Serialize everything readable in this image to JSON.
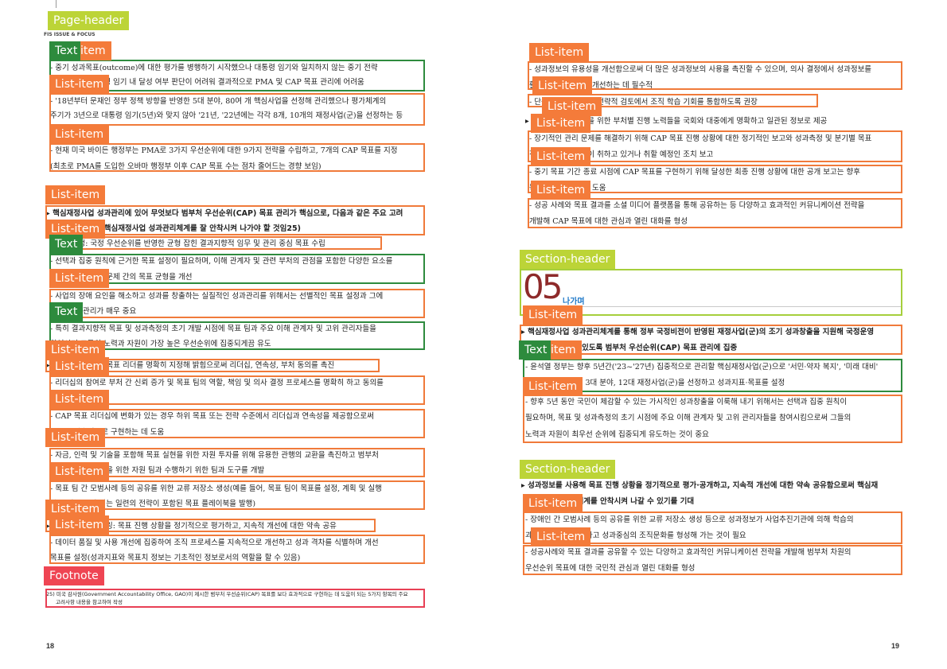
{
  "page_header": {
    "text": "FIS ISSUE & FOCUS"
  },
  "page_numbers": {
    "left": "18",
    "right": "19"
  },
  "section_number": "05",
  "section_title": "나가며",
  "footnote": {
    "line1": "25) 미국 감사원(Government Accountability Office, GAO)이 제시한 범부처 우선순위(CAP) 목표를 보다 효과적으로 구현하는 데 도움이 되는 5가지 항목의 주요",
    "line2": "고려사항 내용을 참고하여 작성"
  },
  "labels": {
    "page_header": "Page-header",
    "text": "Text",
    "list_item": "List-item",
    "section_header": "Section-header",
    "footnote": "Footnote"
  },
  "left_lines": [
    "- 중기 성과목표(outcome)에 대한 평가를 병행하기 시작했으나 대통령 임기와 일치하지 않는 중기 전략",
    "  목표 특성상 대통령 임기 내 달성 여부 판단이 어려워 결과적으로 PMA 및 CAP 목표 관리에 어려움",
    "- '18년부터 문재인 정부 정책 방향을 반영한 5대 분야, 80여 개 핵심사업을 선정해 관리했으나 평가체계의",
    "  주기가 3년으로 대통령 임기(5년)와 맞지 않아 '21년, '22년에는 각각 8개, 10개의 재정사업(군)을 선정하는 등",
    "- 현재 미국 바이든 행정부는 PMA로 3가지 우선순위에 대한 9가지 전략을 수립하고, 7개의 CAP 목표를 지정",
    "  (최초로 PMA를 도입한 오바마 행정부 이후 CAP 목표 수는 점차 줄어드는 경향 보임)",
    "▸ 핵심재정사업 성과관리에 있어 무엇보다 범부처 우선순위(CAP) 목표 관리가 핵심으로, 다음과 같은 주요 고려",
    "  사항을 반영하여 핵심재정사업 성과관리체계를 잘 안착시켜 나가야 할 것임25)",
    "- 목표 설정: 국정 우선순위를 반영한 균형 잡힌 결과지향적 임무 및 관리 중심 목표 수립",
    "- 선택과 집중 원칙에 근거한 목표 설정이 필요하며, 이해 관계자 및 관련 부처의 관점을 포함한 다양한 요소를",
    "  반영하여 관리 및 문제 간의 목표 균형을 개선",
    "- 사업의 장애 요인을 해소하고 성과를 창출하는 실질적인 성과관리를 위해서는 선별적인 목표 설정과 그에",
    "  따른 집중 관리가 매우 중요",
    "- 특히 결과지향적 목표 및 성과측정의 초기 개발 시점에 목표 팀과 주요 이해 관계자 및 고위 관리자들을",
    "  참여시켜 그들의 노력과 자원이 가장 높은 우선순위에 집중되게끔 유도",
    "▸ 리더십: 각 CAP 목표 리더를 명확히 지정해 밝힘으로써 리더십, 연속성, 부처 동의를 촉진",
    "- 리더십의 참여로 부처 간 신뢰 증가 및 목표 팀의 역할, 책임 및 의사 결정 프로세스를 명확히 하고 동의를",
    "  촉진",
    "- CAP 목표 리더십에 변화가 있는 경우 하위 목표 또는 전략 수준에서 리더십과 연속성을 제공함으로써",
    "  목표를 지속적으로 구현하는 데 도움",
    "- 자금, 인력 및 기술을 포함해 목표 실현을 위한 자원 투자를 위해 유용한 관행의 교환을 촉진하고 범부처",
    "  목표 계획 및 조정을 위한 자원 팀과 수행하기 위한 팀과 도구를 개발",
    "- 목표 팀 간 모범사례 등의 공유를 위한 교류 저장소 생성(예를 들어, 목표 팀이 목표를 설정, 계획 및 실행",
    "  하는 데 도움이 되는 일련의 전략이 포함된 목표 플레이북을 발행)",
    "▸ 진행 상황 모니터링: 목표 진행 상황을 정기적으로 평가하고, 지속적 개선에 대한 약속 공유",
    "- 데이터 품질 및 사용 개선에 집중하여 조직 프로세스를 지속적으로 개선하고 성과 격차를 식별하며 개선",
    "  목표를 설정(성과지표와 목표치 정보는 기초적인 정보로서의 역할을 할 수 있음)"
  ],
  "right_lines": [
    "- 성과정보의 유용성을 개선함으로써 더 많은 성과정보의 사용을 촉진할 수 있으며, 의사 결정에서 성과정보를",
    "  활용해 목표 달성을 개선하는 데 필수적",
    "- 단순 성과 보고보다 전략적 검토에서 조직 학습 기회를 통합하도록 권장",
    "▸ 투명성: 목표 달성을 위한 부처별 진행 노력들을 국회와 대중에게 명확하고 일관된 정보로 제공",
    "- 장기적인 관리 문제를 해결하기 위해 CAP 목표 진행 상황에 대한 정기적인 보고와 성과측정 및 분기별 목표",
    "  진행 상황, 목표 팀이 취하고 있거나 취할 예정인 조치 보고",
    "- 중기 목표 기간 종료 시점에 CAP 목표를 구현하기 위해 달성한 최종 진행 상황에 대한 공개 보고는 향후",
    "  목표를 개선하는 데 도움",
    "- 성공 사례와 목표 결과를 소셜 미디어 플랫폼을 통해 공유하는 등 다양하고 효과적인 커뮤니케이션 전략을",
    "  개발해 CAP 목표에 대한 관심과 열린 대화를 형성",
    "▸ 핵심재정사업 성과관리체계를 통해 정부 국정비전이 반영된 재정사업(군)의 조기 성과창출을 지원해 국정운영",
    "  성과를 제고할 수 있도록 범부처 우선순위(CAP) 목표 관리에 집중",
    "- 윤석열 정부는 향후 5년간('23~'27년) 집중적으로 관리할 핵심재정사업(군)으로 '서민·약자 복지', '미래 대비'",
    "  '국가 기능 강화'의 3대 분야, 12대 재정사업(군)을 선정하고 성과지표·목표를 설정",
    "- 향후 5년 동안 국민이 체감할 수 있는 가시적인 성과창출을 이룩해 내기 위해서는 선택과 집중 원칙이",
    "  필요하며, 목표 및 성과측정의 초기 시점에 주요 이해 관계자 및 고위 관리자들을 참여시킴으로써 그들의",
    "  노력과 자원이 최우선 순위에 집중되게 유도하는 것이 중요",
    "▸ 성과정보를 사용해 목표 진행 상황을 정기적으로 평가·공개하고, 지속적 개선에 대한 약속 공유함으로써 핵심재",
    "  정사업 성과관리체계를 안착시켜 나갈 수 있기를 기대",
    "- 장애인 간 모범사례 등의 공유를 위한 교류 저장소 생성 등으로 성과정보가 사업추진기관에 의해 학습의",
    "  과정에 활용되게끔 하고 성과중심의 조직문화를 형성해 가는 것이 필요",
    "- 성공사례와 목표 결과를 공유할 수 있는 다양하고 효과적인 커뮤니케이션 전략을 개발해 범부처 차원의",
    "  우선순위 목표에 대한 국민적 관심과 열린 대화를 형성"
  ]
}
